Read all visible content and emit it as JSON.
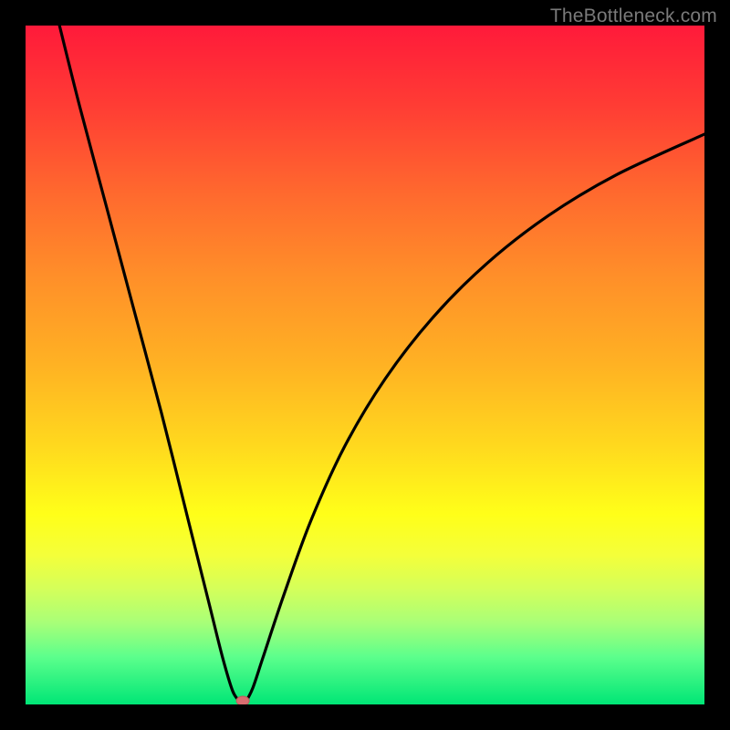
{
  "watermark": "TheBottleneck.com",
  "colors": {
    "gradient_top": "#ff1a3a",
    "gradient_bottom": "#00e676",
    "curve": "#000000",
    "dot": "#d86d70",
    "border": "#000000"
  },
  "chart_data": {
    "type": "line",
    "title": "",
    "xlabel": "",
    "ylabel": "",
    "xlim": [
      0,
      100
    ],
    "ylim": [
      0,
      100
    ],
    "series": [
      {
        "name": "bottleneck-curve",
        "x": [
          5,
          8,
          12,
          16,
          20,
          24,
          27,
          29,
          30.5,
          31.5,
          32,
          32.5,
          33.5,
          35,
          38,
          42,
          47,
          53,
          60,
          68,
          77,
          87,
          100
        ],
        "y": [
          100,
          88,
          73,
          58,
          43,
          27,
          15,
          7,
          2,
          0.5,
          0,
          0.5,
          2.5,
          7,
          16,
          27,
          38,
          48,
          57,
          65,
          72,
          78,
          84
        ]
      }
    ],
    "annotations": [
      {
        "name": "minimum-point",
        "x": 32,
        "y": 0
      }
    ]
  }
}
